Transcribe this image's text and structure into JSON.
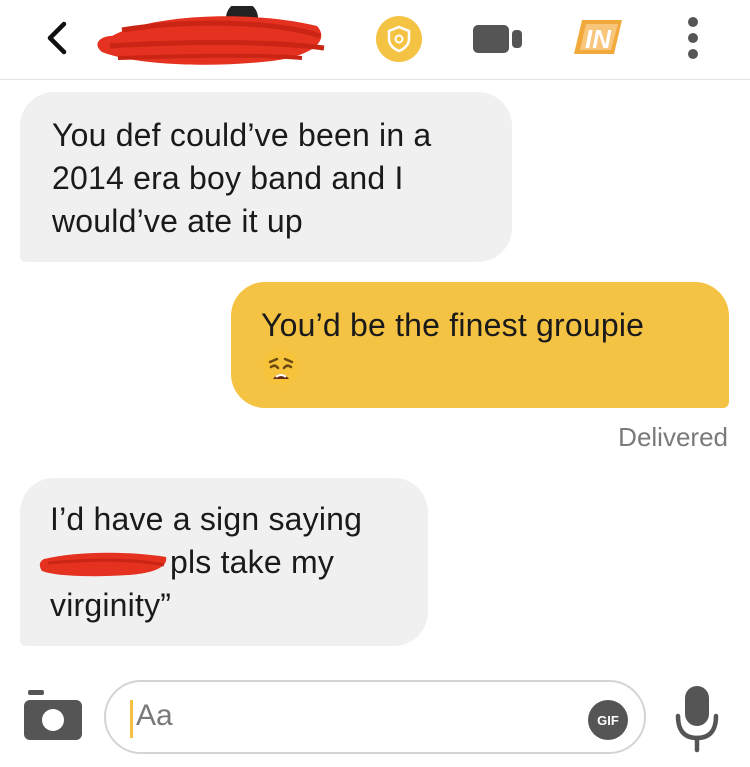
{
  "header": {
    "back_icon": "chevron-left-icon",
    "contact_name_redacted": true,
    "shield_icon": "shield-icon",
    "video_icon": "video-camera-icon",
    "in_badge_text": "IN",
    "more_icon": "more-vertical-icon"
  },
  "messages": [
    {
      "direction": "incoming",
      "lines": [
        "You def could’ve been in a",
        "2014 era boy band and I",
        "would’ve ate it up"
      ]
    },
    {
      "direction": "outgoing",
      "lines": [
        "You’d be the finest groupie"
      ],
      "emoji": "weary-face-emoji"
    },
    {
      "direction": "incoming",
      "lines": [
        "I’d have a sign saying",
        "pls take my",
        "virginity”"
      ]
    }
  ],
  "status": {
    "delivered": "Delivered"
  },
  "composer": {
    "camera_icon": "camera-icon",
    "input_text": "Aa",
    "gif_label": "GIF",
    "mic_icon": "microphone-icon"
  },
  "colors": {
    "accent": "#f5c343",
    "incoming_bubble": "#f0f0f0",
    "redaction": "#e5311f",
    "icon_grey": "#555555",
    "in_badge": "#f2a93b"
  }
}
